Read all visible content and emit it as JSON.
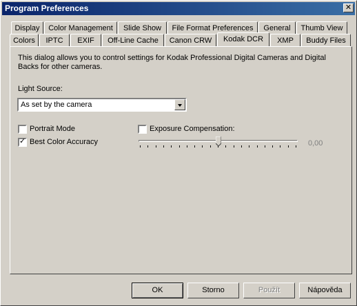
{
  "window": {
    "title": "Program Preferences"
  },
  "tabs_row1": [
    "Display",
    "Color Management",
    "Slide Show",
    "File Format Preferences",
    "General",
    "Thumb View"
  ],
  "tabs_row2": [
    "Colors",
    "IPTC",
    "EXIF",
    "Off-Line Cache",
    "Canon CRW",
    "Kodak DCR",
    "XMP",
    "Buddy Files"
  ],
  "active_tab": "Kodak DCR",
  "panel": {
    "description": "This dialog allows you to control settings for Kodak Professional Digital Cameras and Digital Backs for other cameras.",
    "light_source_label": "Light Source:",
    "light_source_value": "As set by the camera",
    "portrait_mode_label": "Portrait Mode",
    "portrait_mode_checked": false,
    "best_color_label": "Best Color Accuracy",
    "best_color_checked": true,
    "exposure_label": "Exposure Compensation:",
    "exposure_checked": false,
    "exposure_value": "0,00"
  },
  "buttons": {
    "ok": "OK",
    "cancel": "Storno",
    "apply": "Použít",
    "help": "Nápověda"
  }
}
